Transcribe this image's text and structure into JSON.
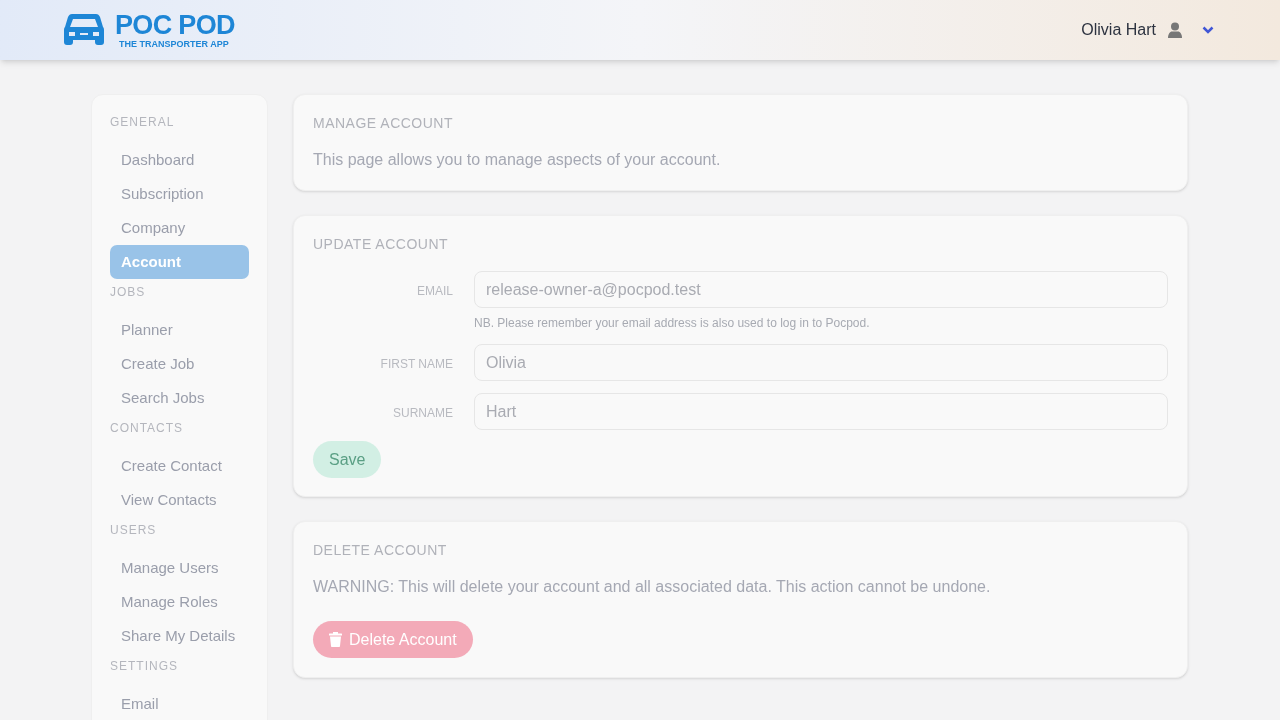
{
  "brand": {
    "name": "POC POD",
    "tagline": "THE TRANSPORTER APP"
  },
  "user": {
    "name": "Olivia Hart"
  },
  "sidebar": {
    "sections": [
      {
        "heading": "GENERAL",
        "items": [
          {
            "label": "Dashboard",
            "selected": false
          },
          {
            "label": "Subscription",
            "selected": false
          },
          {
            "label": "Company",
            "selected": false
          },
          {
            "label": "Account",
            "selected": true
          }
        ]
      },
      {
        "heading": "JOBS",
        "items": [
          {
            "label": "Planner",
            "selected": false
          },
          {
            "label": "Create Job",
            "selected": false
          },
          {
            "label": "Search Jobs",
            "selected": false
          }
        ]
      },
      {
        "heading": "CONTACTS",
        "items": [
          {
            "label": "Create Contact",
            "selected": false
          },
          {
            "label": "View Contacts",
            "selected": false
          }
        ]
      },
      {
        "heading": "USERS",
        "items": [
          {
            "label": "Manage Users",
            "selected": false
          },
          {
            "label": "Manage Roles",
            "selected": false
          },
          {
            "label": "Share My Details",
            "selected": false
          }
        ]
      },
      {
        "heading": "SETTINGS",
        "items": [
          {
            "label": "Email",
            "selected": false
          }
        ]
      }
    ]
  },
  "manage_account": {
    "title": "MANAGE ACCOUNT",
    "text": "This page allows you to manage aspects of your account."
  },
  "update_account": {
    "title": "UPDATE ACCOUNT",
    "fields": [
      {
        "label": "EMAIL",
        "value": "release-owner-a@pocpod.test",
        "hint": "NB. Please remember your email address is also used to log in to Pocpod."
      },
      {
        "label": "FIRST NAME",
        "value": "Olivia"
      },
      {
        "label": "SURNAME",
        "value": "Hart"
      }
    ],
    "save_button": {
      "label": "Save",
      "disabled": true
    }
  },
  "delete_account": {
    "title": "DELETE ACCOUNT",
    "text": "WARNING: This will delete your account and all associated data. This action cannot be undone.",
    "button": "Delete Account"
  }
}
